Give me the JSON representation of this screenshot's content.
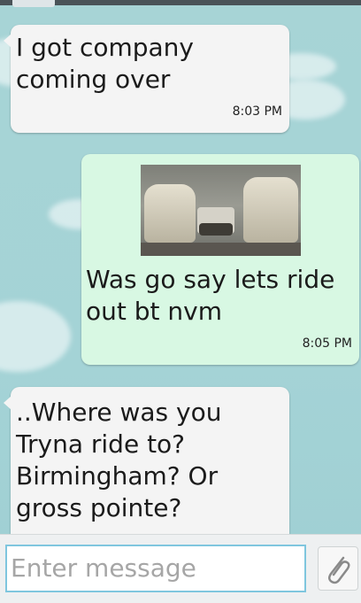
{
  "messages": [
    {
      "direction": "incoming",
      "text": "I got company\ncoming over",
      "time": "8:03 PM"
    },
    {
      "direction": "outgoing",
      "text": "Was go say lets ride\nout bt nvm",
      "time": "8:05 PM",
      "attachment_icon": "car-interior-photo"
    },
    {
      "direction": "incoming",
      "text": "..Where was you\nTryna ride to?\nBirmingham? Or\ngross pointe?",
      "time": ""
    }
  ],
  "composer": {
    "placeholder": "Enter message",
    "attach_icon": "paperclip-icon"
  }
}
